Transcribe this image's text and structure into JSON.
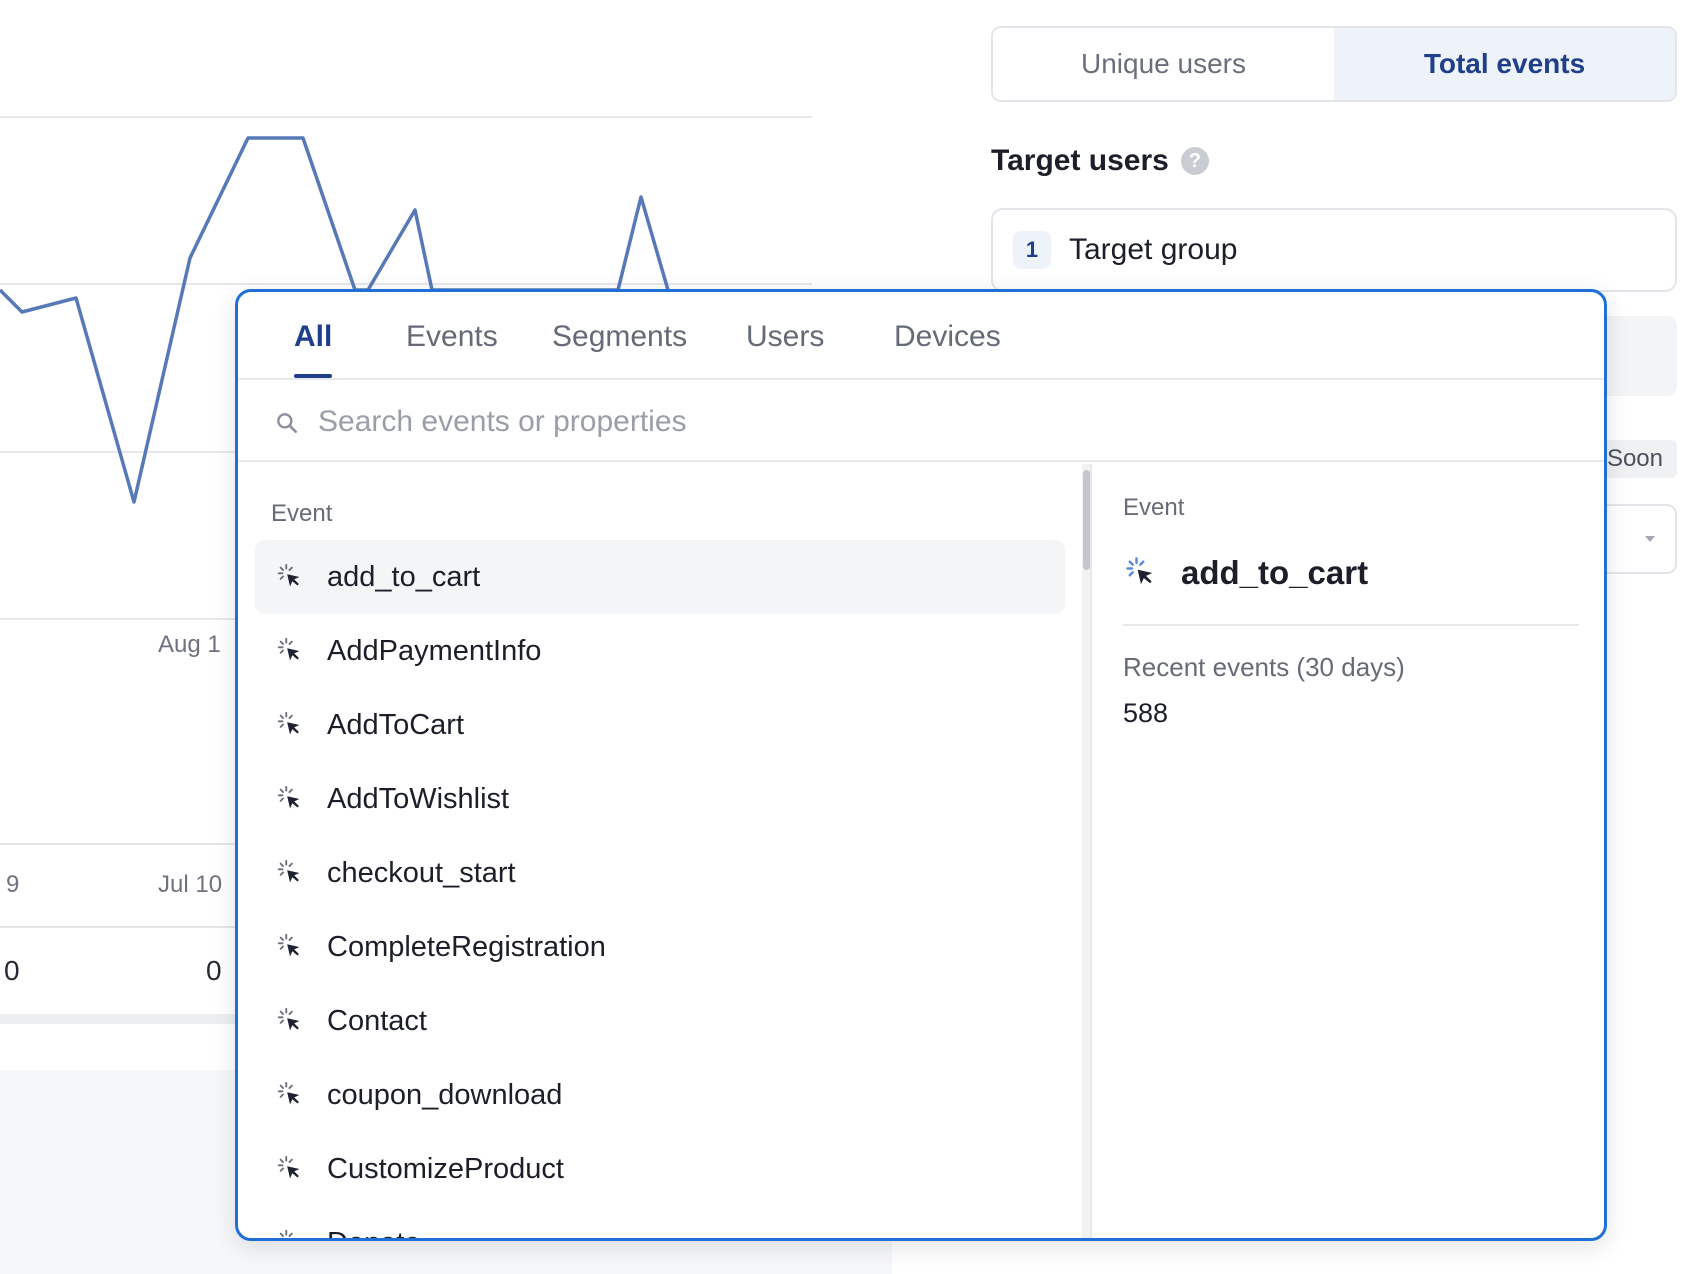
{
  "background_chart": {
    "x_tick_aug": "Aug 1",
    "table_header_left": "9",
    "table_header_right": "Jul 10",
    "table_value_left": "0",
    "table_value_right": "0",
    "line_color": "#5779b8"
  },
  "settings": {
    "metric_toggle": {
      "unique_users": "Unique users",
      "total_events": "Total events",
      "active": "total_events"
    },
    "target_users_label": "Target users",
    "help_icon": "question-circle-icon",
    "target_group": {
      "index": "1",
      "label": "Target group"
    },
    "soon_badge": "Soon"
  },
  "popover": {
    "accent_color": "#1f6fd6",
    "tabs": [
      {
        "label": "All",
        "active": true
      },
      {
        "label": "Events",
        "active": false
      },
      {
        "label": "Segments",
        "active": false
      },
      {
        "label": "Users",
        "active": false
      },
      {
        "label": "Devices",
        "active": false
      }
    ],
    "search": {
      "placeholder": "Search events or properties",
      "value": ""
    },
    "list_section": "Event",
    "events": [
      "add_to_cart",
      "AddPaymentInfo",
      "AddToCart",
      "AddToWishlist",
      "checkout_start",
      "CompleteRegistration",
      "Contact",
      "coupon_download",
      "CustomizeProduct",
      "Donate"
    ],
    "selected_event_index": 0,
    "detail": {
      "section_label": "Event",
      "name": "add_to_cart",
      "metric_label": "Recent events (30 days)",
      "metric_value": "588"
    }
  }
}
